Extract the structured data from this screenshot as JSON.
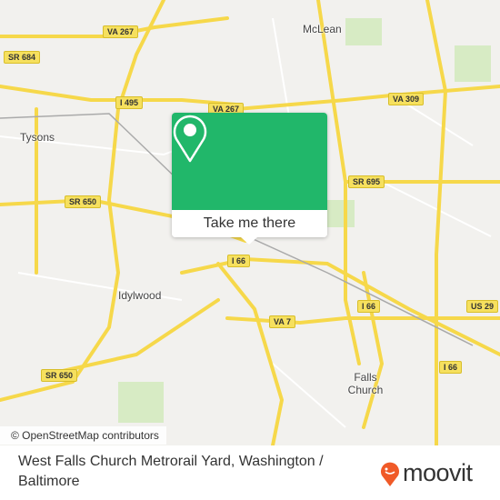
{
  "map": {
    "shields": [
      "VA 267",
      "SR 684",
      "I 495",
      "VA 267",
      "VA 309",
      "SR 695",
      "SR 650",
      "I 66",
      "I 66",
      "VA 7",
      "I 66",
      "US 29",
      "SR 650"
    ],
    "places": [
      "McLean",
      "Tysons",
      "Idylwood",
      "Falls Church"
    ],
    "attribution": "© OpenStreetMap contributors",
    "colors": {
      "road": "#f6d84a",
      "land": "#f2f1ee",
      "park": "#d7ebc4",
      "accent": "#21b76a"
    }
  },
  "popup": {
    "icon": "map-pin-icon",
    "button_label": "Take me there"
  },
  "footer": {
    "title": "West Falls Church Metrorail Yard, Washington / Baltimore",
    "logo_text": "moovit",
    "logo_color": "#f05a28"
  }
}
